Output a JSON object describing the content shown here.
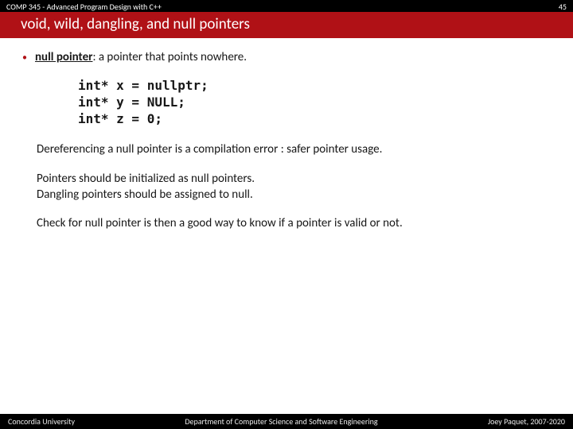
{
  "header": {
    "course": "COMP 345 - Advanced Program Design with C++",
    "page_num": "45"
  },
  "banner": "void, wild, dangling, and null pointers",
  "bullet": {
    "term": "null pointer",
    "rest": ": a pointer that points nowhere."
  },
  "code": "int* x = nullptr;\nint* y = NULL;\nint* z = 0;",
  "p1": "Dereferencing a null pointer is a compilation error : safer pointer usage.",
  "p2a": "Pointers should be initialized as null pointers.",
  "p2b": "Dangling pointers should be assigned to null.",
  "p3": "Check for null pointer is then a good way to know if a pointer is valid or not.",
  "footer": {
    "left": "Concordia University",
    "center": "Department of Computer Science and Software Engineering",
    "right": "Joey Paquet, 2007-2020"
  }
}
